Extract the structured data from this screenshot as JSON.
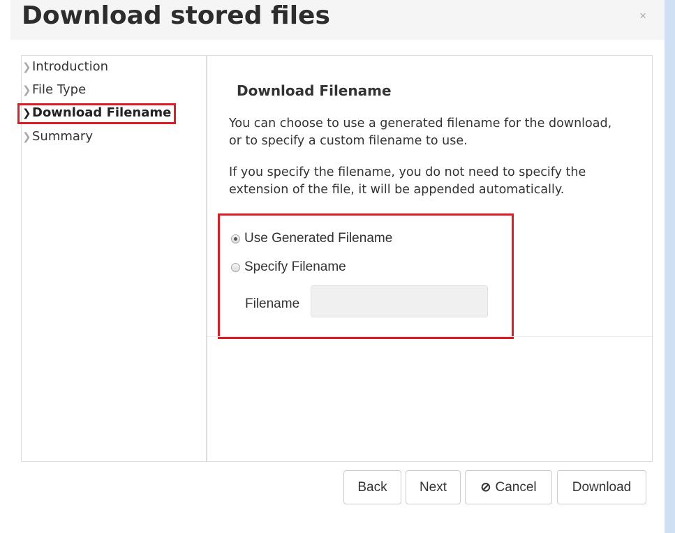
{
  "dialog": {
    "title": "Download stored files",
    "close_glyph": "×"
  },
  "steps": [
    {
      "label": "Introduction",
      "active": false
    },
    {
      "label": "File Type",
      "active": false
    },
    {
      "label": "Download Filename",
      "active": true
    },
    {
      "label": "Summary",
      "active": false
    }
  ],
  "content": {
    "section_title": "Download Filename",
    "paragraph_1": "You can choose to use a generated filename for the download, or to specify a custom filename to use.",
    "paragraph_2": "If you specify the filename, you do not need to specify the extension of the file, it will be appended automatically.",
    "options": {
      "use_generated_label": "Use Generated Filename",
      "use_generated_checked": true,
      "specify_label": "Specify Filename",
      "specify_checked": false,
      "filename_label": "Filename",
      "filename_value": ""
    }
  },
  "footer": {
    "back_label": "Back",
    "next_label": "Next",
    "cancel_label": "Cancel",
    "cancel_icon": "⊘",
    "download_label": "Download"
  },
  "colors": {
    "highlight": "#e01b24",
    "header_bg": "#f5f5f5",
    "side_strip": "#cfe0f4"
  },
  "icons": {
    "chevron": "chevron-right-icon",
    "close": "close-icon",
    "cancel": "ban-icon"
  }
}
